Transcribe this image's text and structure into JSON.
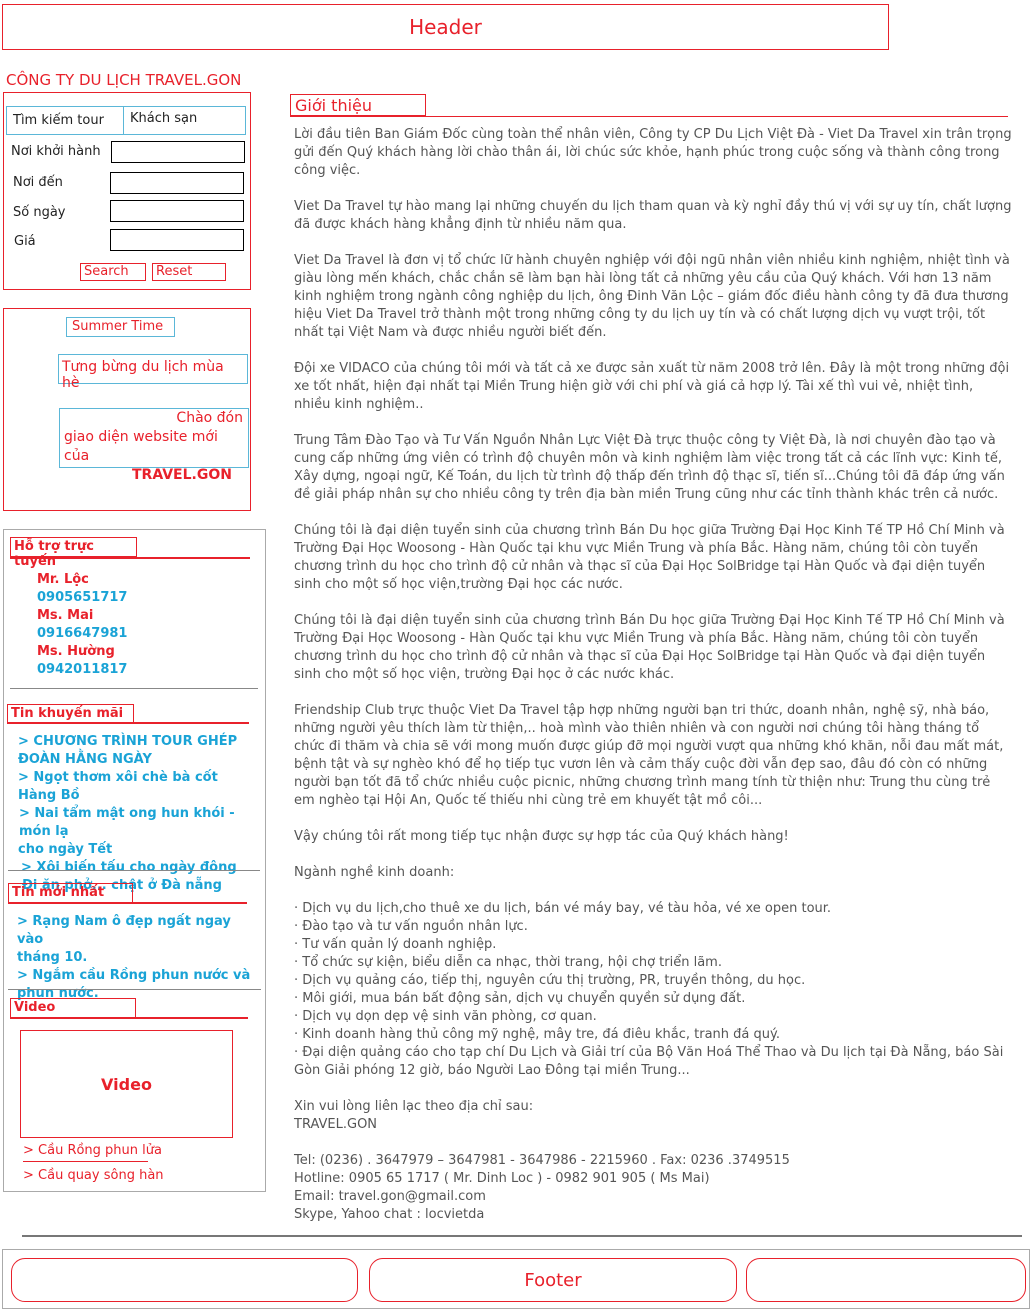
{
  "header": {
    "label": "Header"
  },
  "company": {
    "title": "CÔNG TY DU LỊCH TRAVEL.GON"
  },
  "search": {
    "tab_tour": "Tìm kiếm tour",
    "tab_hotel": "Khách sạn",
    "fields": [
      {
        "label": "Nơi khởi hành",
        "value": ""
      },
      {
        "label": "Nơi đến",
        "value": ""
      },
      {
        "label": "Số ngày",
        "value": ""
      },
      {
        "label": "Giá",
        "value": ""
      }
    ],
    "search_label": "Search",
    "reset_label": "Reset"
  },
  "summer": {
    "badge": "Summer Time",
    "promo1": "Tưng bừng du lịch mùa hè",
    "promo2_line1": "Chào đón",
    "promo2_line2": "giao diện website mới của",
    "promo2_line3": "TRAVEL.GON"
  },
  "support": {
    "title": "Hỗ trợ trực tuyến",
    "contacts": [
      {
        "name": "Mr. Lộc",
        "phone": "0905651717"
      },
      {
        "name": "Ms. Mai",
        "phone": "0916647981"
      },
      {
        "name": "Ms. Hường",
        "phone": "0942011817"
      }
    ]
  },
  "promos": {
    "title": "Tin khuyến mãi",
    "items": [
      "> CHƯƠNG TRÌNH TOUR GHÉP",
      "ĐOÀN HẰNG NGÀY",
      "> Ngọt thơm xôi chè bà cốt Hàng Bồ",
      "> Nai tẩm mật ong hun khói - món lạ",
      "cho ngày Tết",
      "> Xôi biến tấu cho ngày đông",
      "Đi ăn phở... chật ở Đà nẵng"
    ]
  },
  "news": {
    "title": "Tin mới nhất",
    "items": [
      "> Rạng Nam ô đẹp ngất ngay vào",
      "tháng 10.",
      "> Ngắm cầu Rồng phun nước và",
      "phun nước."
    ]
  },
  "video": {
    "title": "Video",
    "placeholder": "Video",
    "links": [
      "> Cầu Rồng phun lửa",
      "> Cầu quay sông hàn"
    ]
  },
  "intro": {
    "title": "Giới thiệu",
    "paragraphs": [
      "Lời đầu tiên Ban Giám Đốc cùng toàn thể nhân viên,  Công ty CP Du Lịch Việt Đà - Viet Da Travel xin trân trọng gửi đến Quý khách hàng lời chào thân ái, lời chúc sức khỏe, hạnh phúc trong cuộc sống và thành công trong công việc.",
      "Viet Da Travel tự hào mang lại những chuyến du lịch tham quan và kỳ nghỉ đầy thú vị với sự uy tín,  chất lượng đã được khách hàng khẳng định từ nhiều năm qua.",
      "Viet Da Travel là đơn vị tổ chức lữ hành chuyên nghiệp với đội ngũ nhân viên nhiều kinh nghiệm, nhiệt tình và giàu lòng mến khách, chắc chắn sẽ làm bạn hài lòng tất cả những yêu cầu của Quý khách. Với hơn 13 năm kinh nghiệm trong ngành công nghiệp du lịch, ông Đinh Văn Lộc – giám đốc điều hành công ty đã đưa thương hiệu Viet Da Travel trở thành một trong những công ty du lịch uy tín và có chất lượng dịch vụ vượt trội, tốt nhất tại Việt Nam và được nhiều người biết đến.",
      "Đội xe VIDACO của chúng tôi mới và tất cả xe được sản xuất từ năm 2008 trở lên. Đây là một trong những đội xe tốt nhất, hiện đại nhất  tại Miền Trung hiện giờ với chi phí và giá cả hợp lý. Tài xế thì vui vẻ, nhiệt tình, nhiều kinh nghiệm..",
      "Trung Tâm Đào Tạo và Tư Vấn Nguồn Nhân Lực Việt Đà trực thuộc công ty Việt Đà, là nơi chuyên đào tạo và cung cấp những ứng viên có trình độ chuyên môn và kinh nghiệm làm việc trong tất cả các lĩnh vực: Kinh tế, Xây dựng, ngoại ngữ, Kế Toán, du lịch từ trình độ thấp đến trình độ thạc sĩ, tiến sĩ...Chúng tôi đã đáp ứng vấn đề giải pháp nhân sự cho nhiều công ty trên địa bàn miền Trung cũng như các tỉnh thành khác trên cả nước.",
      "Chúng tôi là đại diện tuyển sinh của chương trình Bán Du học  giữa  Trường Đại Học Kinh Tế TP Hồ Chí Minh và Trường Đại Học Woosong - Hàn Quốc tại khu vực Miền Trung và phía Bắc. Hàng năm, chúng tôi còn tuyển chương trình du học cho trình độ cử nhân và thạc sĩ của Đại Học SolBridge tại Hàn Quốc và đại diện tuyển sinh cho một số học  viện,trường Đại học các nước.",
      " Chúng tôi là đại diện tuyển sinh của chương trình Bán Du học  giữa  Trường Đại Học Kinh Tế TP Hồ Chí Minh và Trường Đại Học Woosong - Hàn Quốc tại khu vực Miền Trung và phía Bắc. Hàng năm, chúng tôi còn tuyển chương trình du học cho trình độ cử nhân và thạc sĩ của Đại Học SolBridge tại Hàn Quốc và đại diện tuyển sinh cho một số học viện, trường Đại học ở các nước khác.",
      " Friendship Club trực thuộc Viet Da Travel  tập hợp những người bạn tri thức, doanh nhân, nghệ sỹ, nhà báo, những người  yêu thích làm từ thiện,.. hoà mình vào thiên nhiên và con người nơi chúng tôi hàng tháng tổ chức đi thăm và chia sẽ với mong muốn được giúp đỡ mọi người vượt qua những khó khăn, nỗi đau mất mát, bệnh tật và sự nghèo khó để họ tiếp tục vươn lên và cảm thấy cuộc đời vẫn đẹp sao,  đâu đó còn có những người bạn tốt   đã tổ chức nhiều cuộc picnic, những chương trình mang tính từ thiện như: Trung thu cùng trẻ em nghèo tại Hội An, Quốc tế thiếu nhi cùng trẻ em khuyết tật mồ côi...",
      " Vậy chúng tôi rất mong tiếp tục nhận được sự hợp tác của Quý khách hàng!",
      "  Ngành nghề kinh doanh:"
    ],
    "services": [
      " · Dịch vụ du lịch,cho thuê xe du lịch, bán vé máy bay, vé tàu hỏa, vé xe open tour.",
      " · Đào tạo và tư vấn nguồn nhân lực.",
      " · Tư vấn quản lý doanh nghiệp.",
      " · Tổ chức sự kiện, biểu diễn ca nhạc, thời trang, hội chợ triển lãm.",
      " · Dịch vụ quảng cáo, tiếp thị, nguyên cứu thị trường, PR, truyền thông, du học.",
      " · Môi giới, mua bán bất động sản, dịch vụ chuyển quyền sử dụng đất.",
      " · Dịch vụ dọn dẹp vệ sinh văn phòng, cơ quan.",
      " · Kinh doanh hàng thủ công mỹ nghệ, mây tre, đá điêu khắc, tranh đá quý.",
      " · Đại diện quảng cáo cho tạp chí Du Lịch và Giải trí của Bộ Văn Hoá Thể Thao và Du lịch tại Đà Nẵng, báo Sài Gòn Giải phóng 12 giờ, báo Người Lao Đông tại miền Trung..."
    ],
    "contact_intro": "  Xin vui lòng liên lạc theo địa chỉ sau:",
    "contact_company": "   TRAVEL.GON",
    "contact_lines": [
      "   Tel: (0236) . 3647979 – 3647981 - 3647986  - 2215960 . Fax: 0236 .3749515",
      "   Hotline: 0905 65 1717 ( Mr. Dinh Loc )  - 0982 901 905 ( Ms Mai)",
      "   Email: travel.gon@gmail.com",
      "   Skype, Yahoo chat : locvietda"
    ]
  },
  "footer": {
    "label": "Footer"
  }
}
